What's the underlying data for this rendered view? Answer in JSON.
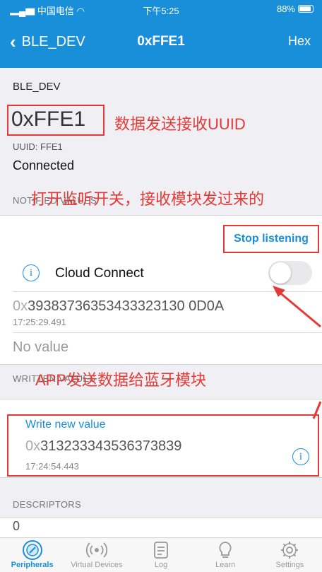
{
  "statusbar": {
    "carrier": "中国电信",
    "time": "下午5:25",
    "battery": "88%"
  },
  "nav": {
    "back_label": "BLE_DEV",
    "title": "0xFFE1",
    "right_label": "Hex"
  },
  "device": {
    "name": "BLE_DEV",
    "uuid_big": "0xFFE1",
    "uuid_small": "UUID: FFE1",
    "status": "Connected"
  },
  "annotations": {
    "uuid_note": "数据发送接收UUID",
    "listen_note": "打开监听开关，接收模块发过来的",
    "write_note": "APP发送数据给蓝牙模块"
  },
  "notified": {
    "header": "NOTIFIED VALUES",
    "stop_label": "Stop listening",
    "cloud_label": "Cloud Connect",
    "toggle_on": false,
    "value_prefix": "0x",
    "value": "39383736353433323130 0D0A",
    "timestamp": "17:25:29.491",
    "no_value": "No value"
  },
  "written": {
    "header": "WRITTEN VALUES",
    "write_label": "Write new value",
    "value_prefix": "0x",
    "value": "313233343536373839",
    "timestamp": "17:24:54.443"
  },
  "descriptors": {
    "header": "DESCRIPTORS",
    "value": "0"
  },
  "tabs": [
    {
      "label": "Peripherals",
      "icon": "peripherals-icon",
      "active": true
    },
    {
      "label": "Virtual Devices",
      "icon": "broadcast-icon",
      "active": false
    },
    {
      "label": "Log",
      "icon": "log-icon",
      "active": false
    },
    {
      "label": "Learn",
      "icon": "lightbulb-icon",
      "active": false
    },
    {
      "label": "Settings",
      "icon": "gear-icon",
      "active": false
    }
  ],
  "colors": {
    "accent": "#1a8fd9",
    "annotation": "#e53935"
  }
}
